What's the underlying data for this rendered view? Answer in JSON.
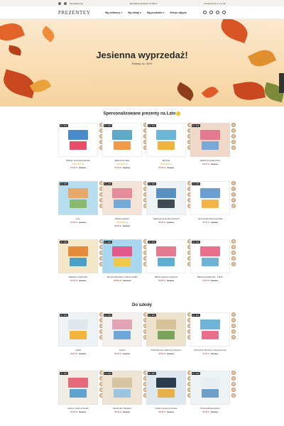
{
  "topbar": {
    "left": "Skontaktuj się",
    "mid": "Bezpłatna dostawa od 199 zł",
    "right": "Dostarczamy w 2-4 dni"
  },
  "header": {
    "logo": "PREZENTEY",
    "nav": [
      "Wg odbiorcy",
      "Wg okazji",
      "Wg produktu",
      "Sekcje zdjęcie"
    ]
  },
  "hero": {
    "title": "Jesienna wyprzedaż!",
    "subtitle": "Rabaty do -50%"
  },
  "section1": {
    "title": "Spersonalizowane prezenty na Lato",
    "rows": [
      [
        {
          "badge": "Do -50%",
          "name": "Babcia i wnuczka koszulka",
          "stars": "★★★★★ (5)",
          "price": "79,00 zł",
          "old": "99,00 zł",
          "colors": [
            "#ffffff",
            "#4a8bc9",
            "#e84e6a"
          ]
        },
        {
          "badge": "Do -50%",
          "name": "Babcia koszulka",
          "stars": "★★★★★ (4)",
          "price": "79,00 zł",
          "old": "99,00 zł",
          "colors": [
            "#ffffff",
            "#5fa9c8",
            "#f29b4a"
          ]
        },
        {
          "badge": "Do -50%",
          "name": "Mój Tata",
          "stars": "★★★★★ (3)",
          "price": "79,00 zł",
          "old": "99,00 zł",
          "colors": [
            "#ffffff",
            "#6cb7d8",
            "#f0b33e"
          ]
        },
        {
          "badge": "Do -50%",
          "name": "Babcia koszulka torba",
          "stars": "",
          "price": "69,00 zł",
          "old": "89,00 zł",
          "colors": [
            "#f0d9c8",
            "#e37a8f",
            "#7aa7d8"
          ]
        }
      ],
      [
        {
          "badge": "Do -50%",
          "name": "Lato",
          "stars": "",
          "price": "79,00 zł",
          "old": "99,00 zł",
          "colors": [
            "#b8dff0",
            "#e7a86b",
            "#8ab96e"
          ]
        },
        {
          "badge": "Do -50%",
          "name": "Babcia wyjazdu",
          "stars": "★★★★★ (2)",
          "price": "69,00 zł",
          "old": "89,00 zł",
          "colors": [
            "#f3e4d7",
            "#e58c9c",
            "#76a9d8"
          ]
        },
        {
          "badge": "Do -50%",
          "name": "wakacyjni wodo-dla rasowych",
          "stars": "",
          "price": "59,00 zł",
          "old": "79,00 zł",
          "colors": [
            "#eef3f6",
            "#5a8fc1",
            "#3f4a56"
          ]
        },
        {
          "badge": "Do -50%",
          "name": "Spersonalizowana koszulka",
          "stars": "",
          "price": "79,00 zł",
          "old": "99,00 zł",
          "colors": [
            "#ffffff",
            "#6c9fd0",
            "#f3b54a"
          ]
        }
      ],
      [
        {
          "badge": "Do -50%",
          "name": "Najlepszy wyjazd lato",
          "stars": "",
          "price": "59,00 zł",
          "old": "79,00 zł",
          "colors": [
            "#f5e8c8",
            "#e58b3b",
            "#4aa0c7"
          ]
        },
        {
          "badge": "Do -50%",
          "name": "Spersonalizowany rodzinne grafiki",
          "stars": "",
          "price": "109,00 zł",
          "old": "139,00 zł",
          "colors": [
            "#a9d7f0",
            "#e05a8c",
            "#f2c84b"
          ]
        },
        {
          "badge": "Do -50%",
          "name": "Babcia wyjazdu piaskowa",
          "stars": "",
          "price": "69,00 zł",
          "old": "89,00 zł",
          "colors": [
            "#ffffff",
            "#e37a8f",
            "#5fb0d0"
          ]
        },
        {
          "badge": "Do -50%",
          "name": "Babcia koszulka lato - Tylkoo",
          "stars": "",
          "price": "79,00 zł",
          "old": "99,00 zł",
          "colors": [
            "#ffffff",
            "#e96f8b",
            "#6fb3d6"
          ]
        }
      ]
    ]
  },
  "section2": {
    "title": "Do szkoły",
    "rows": [
      [
        {
          "badge": "Do -50%",
          "name": "Jesteś",
          "stars": "",
          "price": "59,00 zł",
          "old": "69,00 zł",
          "colors": [
            "#eef3f6",
            "#e0e8ee",
            "#f4b63a"
          ]
        },
        {
          "badge": "Do -50%",
          "name": "Jestem",
          "stars": "",
          "price": "59,00 zł",
          "old": "69,00 zł",
          "colors": [
            "#f3f1ee",
            "#e3a4b8",
            "#6fa8d8"
          ]
        },
        {
          "badge": "Do -50%",
          "name": "Szkolnikie eko, lekko byt szkolnym",
          "stars": "",
          "price": "49,00 zł",
          "old": "59,00 zł",
          "colors": [
            "#ede2cc",
            "#d8c29a",
            "#7aa35c"
          ]
        },
        {
          "badge": "Do -50%",
          "name": "Plecaczek \"Pierwszy\" szkolnej konto",
          "stars": "",
          "price": "79,00 zł",
          "old": "99,00 zł",
          "colors": [
            "#ffffff",
            "#6fb3d6",
            "#e96f8b"
          ]
        }
      ],
      [
        {
          "badge": "Do -50%",
          "name": "Zeszyt i torba na kredki",
          "stars": "",
          "price": "49,00 zł",
          "old": "59,00 zł",
          "colors": [
            "#f2ede4",
            "#e46a7a",
            "#5fa1cf"
          ]
        },
        {
          "badge": "Do -50%",
          "name": "Worek dla z literkami",
          "stars": "",
          "price": "49,00 zł",
          "old": "59,00 zł",
          "colors": [
            "#efe4d3",
            "#d6c4a2",
            "#9bc5de"
          ]
        },
        {
          "badge": "Do -50%",
          "name": "Kredki i worek na obuwie",
          "stars": "",
          "price": "49,00 zł",
          "old": "59,00 zł",
          "colors": [
            "#dfe8ee",
            "#2d3b4f",
            "#e6b14a"
          ]
        },
        {
          "badge": "Do -50%",
          "name": "Personalizacja bidonu",
          "stars": "",
          "price": "59,00 zł",
          "old": "69,00 zł",
          "colors": [
            "#eef3f6",
            "#e8eef2",
            "#6e9fc9"
          ]
        }
      ]
    ]
  }
}
